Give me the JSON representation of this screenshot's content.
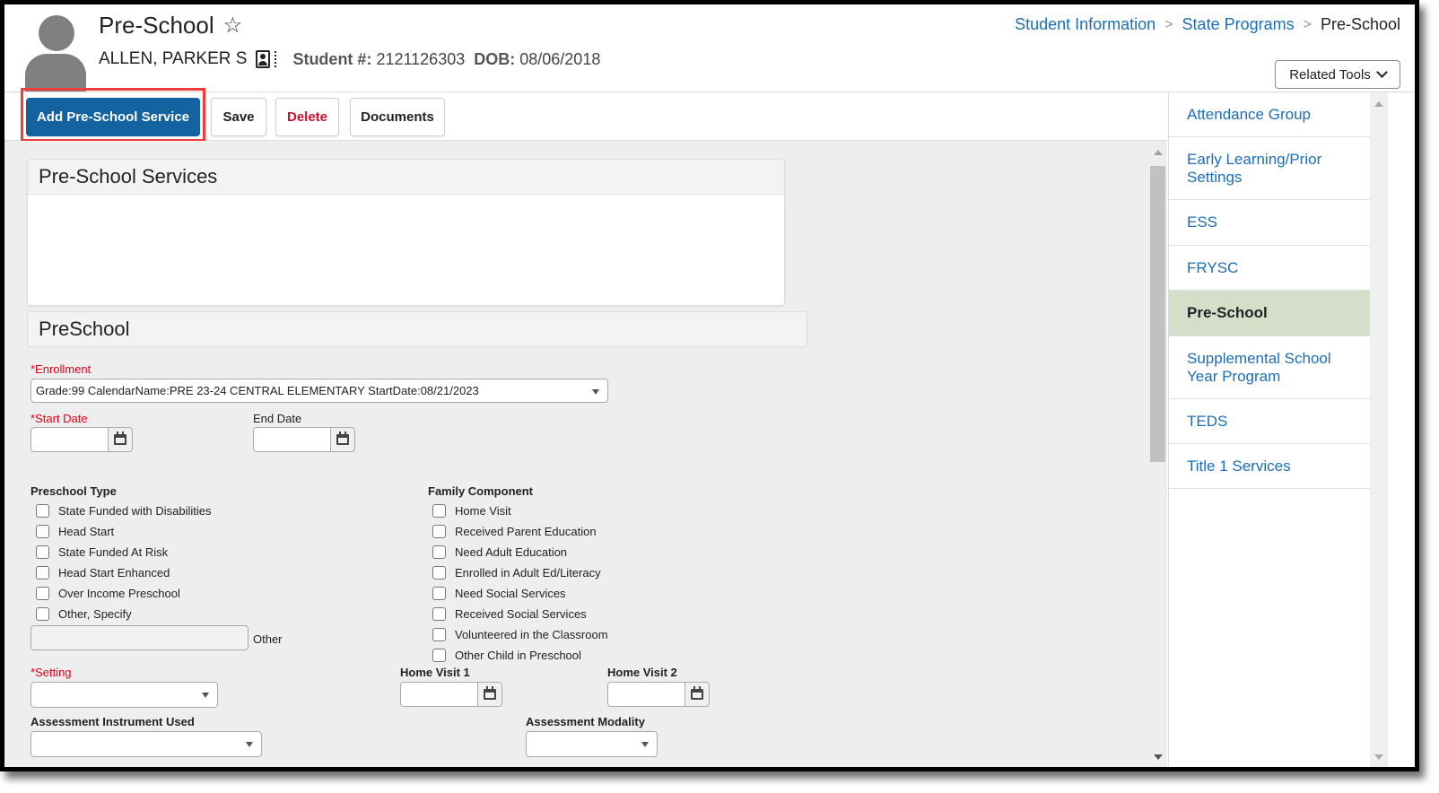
{
  "header": {
    "title": "Pre-School",
    "student_name": "ALLEN, PARKER S",
    "student_number_label": "Student #:",
    "student_number": "2121126303",
    "dob_label": "DOB:",
    "dob": "08/06/2018",
    "breadcrumb": [
      {
        "label": "Student Information",
        "link": true
      },
      {
        "label": "State Programs",
        "link": true
      },
      {
        "label": "Pre-School",
        "link": false
      }
    ],
    "related_tools_label": "Related Tools"
  },
  "toolbar": {
    "add_label": "Add Pre-School Service",
    "save_label": "Save",
    "delete_label": "Delete",
    "documents_label": "Documents"
  },
  "services_panel": {
    "title": "Pre-School Services"
  },
  "form": {
    "section_title": "PreSchool",
    "enrollment_label": "*Enrollment",
    "enrollment_value": "Grade:99 CalendarName:PRE 23-24 CENTRAL ELEMENTARY StartDate:08/21/2023",
    "start_date_label": "*Start Date",
    "start_date_value": "",
    "end_date_label": "End Date",
    "end_date_value": "",
    "preschool_type_label": "Preschool Type",
    "preschool_types": [
      {
        "label": "State Funded with Disabilities",
        "checked": false
      },
      {
        "label": "Head Start",
        "checked": false
      },
      {
        "label": "State Funded At Risk",
        "checked": false
      },
      {
        "label": "Head Start Enhanced",
        "checked": false
      },
      {
        "label": "Over Income Preschool",
        "checked": false
      },
      {
        "label": "Other, Specify",
        "checked": false
      }
    ],
    "other_label": "Other",
    "other_value": "",
    "family_component_label": "Family Component",
    "family_components": [
      {
        "label": "Home Visit",
        "checked": false
      },
      {
        "label": "Received Parent Education",
        "checked": false
      },
      {
        "label": "Need Adult Education",
        "checked": false
      },
      {
        "label": "Enrolled in Adult Ed/Literacy",
        "checked": false
      },
      {
        "label": "Need Social Services",
        "checked": false
      },
      {
        "label": "Received Social Services",
        "checked": false
      },
      {
        "label": "Volunteered in the Classroom",
        "checked": false
      },
      {
        "label": "Other Child in Preschool",
        "checked": false
      }
    ],
    "setting_label": "*Setting",
    "setting_value": "",
    "home_visit_1_label": "Home Visit 1",
    "home_visit_2_label": "Home Visit 2",
    "assessment_instrument_label": "Assessment Instrument Used",
    "assessment_instrument_value": "",
    "assessment_modality_label": "Assessment Modality",
    "assessment_modality_value": ""
  },
  "sidebar": {
    "items": [
      {
        "label": "Attendance Group",
        "active": false
      },
      {
        "label": "Early Learning/Prior Settings",
        "active": false
      },
      {
        "label": "ESS",
        "active": false
      },
      {
        "label": "FRYSC",
        "active": false
      },
      {
        "label": "Pre-School",
        "active": true
      },
      {
        "label": "Supplemental School Year Program",
        "active": false
      },
      {
        "label": "TEDS",
        "active": false
      },
      {
        "label": "Title 1 Services",
        "active": false
      }
    ]
  },
  "colors": {
    "primary": "#1462a0",
    "link": "#1e6db7",
    "danger": "#c8102e",
    "required": "#e1001a",
    "active_nav": "#d5dec8",
    "highlight_box": "#ee3b3b"
  }
}
